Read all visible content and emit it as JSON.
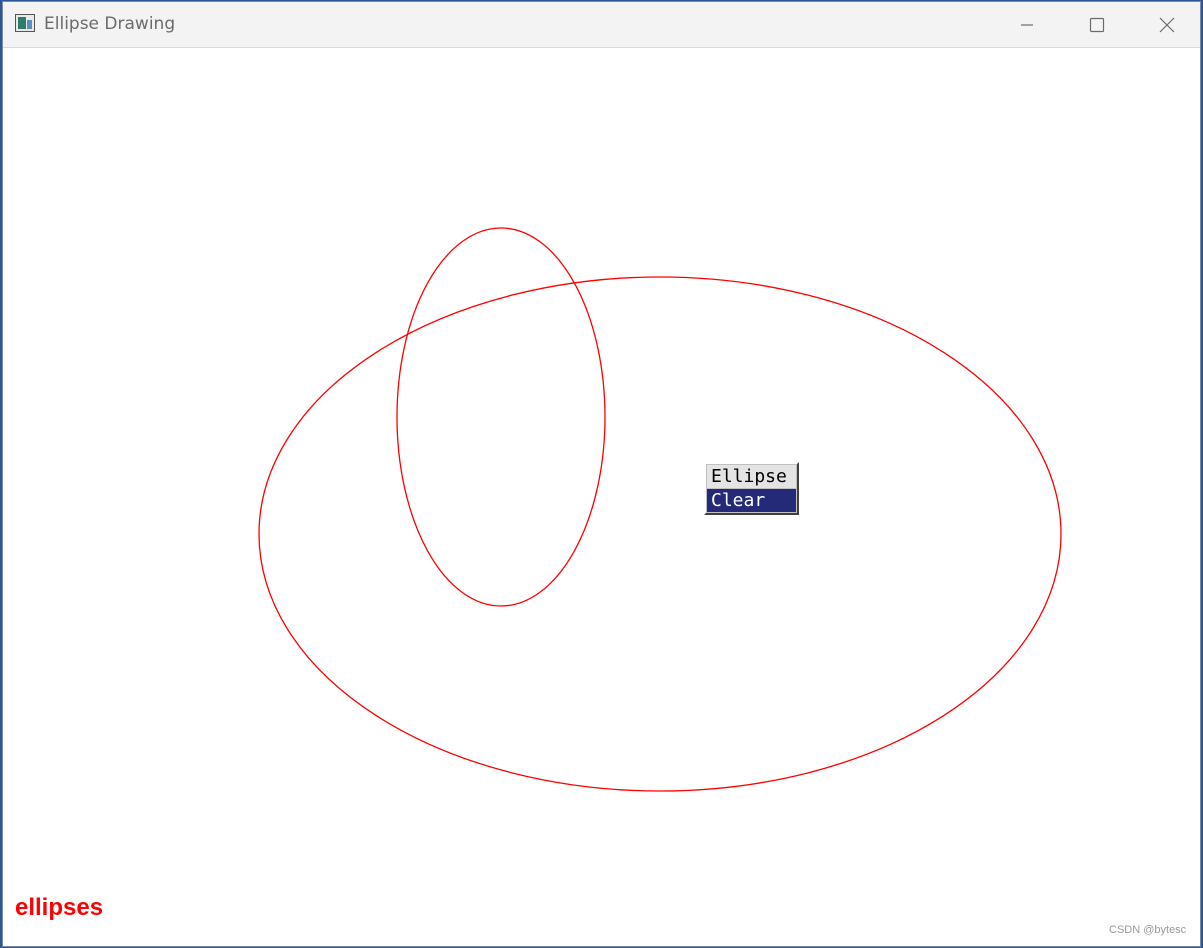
{
  "window": {
    "title": "Ellipse Drawing",
    "app_icon": "window-app-icon",
    "controls": {
      "minimize_icon": "minimize-icon",
      "maximize_icon": "maximize-icon",
      "close_icon": "close-icon"
    }
  },
  "canvas": {
    "background": "#ffffff",
    "stroke_color": "#ff0000",
    "shapes": [
      {
        "type": "ellipse",
        "description": "large horizontal ellipse"
      },
      {
        "type": "ellipse",
        "description": "tall vertical ellipse"
      }
    ]
  },
  "context_menu": {
    "items": [
      {
        "label": "Ellipse",
        "highlighted": false
      },
      {
        "label": "Clear",
        "highlighted": true
      }
    ],
    "highlight_color": "#252a78"
  },
  "status_label": "ellipses",
  "status_label_color": "#ff0000",
  "watermark": "CSDN @bytesc"
}
